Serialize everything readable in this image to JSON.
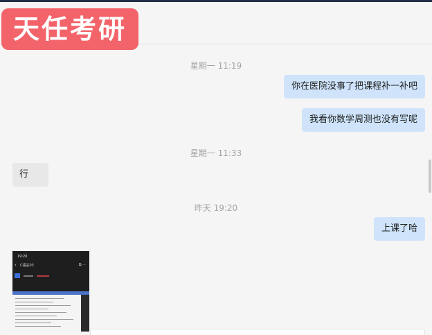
{
  "watermark": {
    "text": "天任考研"
  },
  "messages": [
    {
      "type": "time",
      "text": "星期一 11:19"
    },
    {
      "type": "sent",
      "text": "你在医院没事了把课程补一补吧"
    },
    {
      "type": "sent",
      "text": "我看你数学周测也没有写呢"
    },
    {
      "type": "time",
      "text": "星期一 11:33"
    },
    {
      "type": "received",
      "text": "行"
    },
    {
      "type": "time",
      "text": "昨天 19:20"
    },
    {
      "type": "sent",
      "text": "上课了哈"
    },
    {
      "type": "received-image",
      "caption": ""
    }
  ],
  "screenshot_thumb": {
    "status_time": "19:20",
    "page_title": "C语言03",
    "back_glyph": "‹",
    "icons": "⧉ ⋯"
  },
  "colors": {
    "sent_bubble": "#cfe4fb",
    "received_bubble": "#e8e8e8",
    "watermark_bg": "#f2646a"
  }
}
